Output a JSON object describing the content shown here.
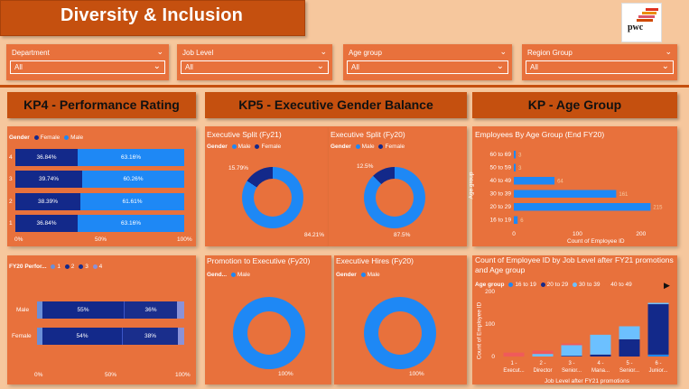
{
  "header": {
    "title": "Diversity & Inclusion",
    "logo_text": "pwc"
  },
  "slicers": [
    {
      "label": "Department",
      "value": "All"
    },
    {
      "label": "Job Level",
      "value": "All"
    },
    {
      "label": "Age group",
      "value": "All"
    },
    {
      "label": "Region Group",
      "value": "All"
    }
  ],
  "sections": {
    "kp4": "KP4 - Performance Rating",
    "kp5": "KP5 - Executive Gender Balance",
    "kp_age": "KP - Age Group"
  },
  "perf_rating": {
    "legend_title": "Gender",
    "legend": [
      "Female",
      "Male"
    ],
    "rows": [
      {
        "label": "4",
        "female": "36.84%",
        "male": "63.16%",
        "female_frac": 0.3684
      },
      {
        "label": "3",
        "female": "39.74%",
        "male": "60.26%",
        "female_frac": 0.3974
      },
      {
        "label": "2",
        "female": "38.39%",
        "male": "61.61%",
        "female_frac": 0.3839
      },
      {
        "label": "1",
        "female": "36.84%",
        "male": "63.16%",
        "female_frac": 0.3684
      }
    ],
    "axis": [
      "0%",
      "50%",
      "100%"
    ]
  },
  "fy20_perf": {
    "legend_title": "FY20 Perfor...",
    "legend": [
      "1",
      "2",
      "3",
      "4"
    ],
    "rows": [
      {
        "label": "Male",
        "seg2": "55%",
        "seg3": "36%"
      },
      {
        "label": "Female",
        "seg2": "54%",
        "seg3": "38%"
      }
    ],
    "axis": [
      "0%",
      "50%",
      "100%"
    ]
  },
  "exec_split_fy21": {
    "title": "Executive Split (Fy21)",
    "legend_title": "Gender",
    "legend": [
      "Male",
      "Female"
    ],
    "small_label": "15.79%",
    "large_label": "84.21%",
    "small_frac": 0.1579
  },
  "exec_split_fy20": {
    "title": "Executive Split (Fy20)",
    "legend_title": "Gender",
    "legend": [
      "Male",
      "Female"
    ],
    "small_label": "12.5%",
    "large_label": "87.5%",
    "small_frac": 0.125
  },
  "promo_exec": {
    "title": "Promotion to Executive (Fy20)",
    "legend_title": "Gend...",
    "legend": [
      "Male"
    ],
    "label": "100%"
  },
  "exec_hires": {
    "title": "Executive Hires (Fy20)",
    "legend_title": "Gender",
    "legend": [
      "Male"
    ],
    "label": "100%"
  },
  "age_chart": {
    "title": "Employees By Age Group (End FY20)",
    "ylabel": "Age group",
    "xlabel": "Count of Employee ID",
    "categories": [
      "60 to 69",
      "50 to 59",
      "40 to 49",
      "30 to 39",
      "20 to 29",
      "16 to 19"
    ],
    "values": [
      3,
      3,
      64,
      161,
      215,
      6
    ],
    "value_labels": [
      "3",
      "3",
      "64",
      "161",
      "215",
      "6"
    ],
    "ticks": [
      "0",
      "100",
      "200"
    ],
    "xmax": 240
  },
  "job_level_chart": {
    "title": "Count of Employee ID by Job Level after FY21 promotions and Age group",
    "legend_title": "Age group",
    "legend": [
      "16 to 19",
      "20 to 29",
      "30 to 39",
      "40 to 49"
    ],
    "ylabel": "Count of Employee ID",
    "xlabel": "Job Level after FY21 promotions",
    "yticks": [
      "0",
      "100",
      "200"
    ],
    "categories": [
      "1 - Execut...",
      "2 - Director",
      "3 - Senior...",
      "4 - Mana...",
      "5 - Senior...",
      "6 - Junior..."
    ],
    "stacks": [
      {
        "s16": 0,
        "s20": 0,
        "s30": 0,
        "s40": 12
      },
      {
        "s16": 0,
        "s20": 0,
        "s30": 8,
        "s40": 10
      },
      {
        "s16": 0,
        "s20": 2,
        "s30": 33,
        "s40": 5
      },
      {
        "s16": 0,
        "s20": 6,
        "s30": 61,
        "s40": 0
      },
      {
        "s16": 0,
        "s20": 53,
        "s30": 40,
        "s40": 0
      },
      {
        "s16": 6,
        "s20": 155,
        "s30": 4,
        "s40": 0
      }
    ],
    "ymax": 200
  },
  "colors": {
    "panel": "#e8713c",
    "header": "#c5500f",
    "dark_blue": "#13298a",
    "blue": "#1e88f5",
    "light_blue": "#6cc0ff",
    "nav": "#2a3ea0"
  }
}
